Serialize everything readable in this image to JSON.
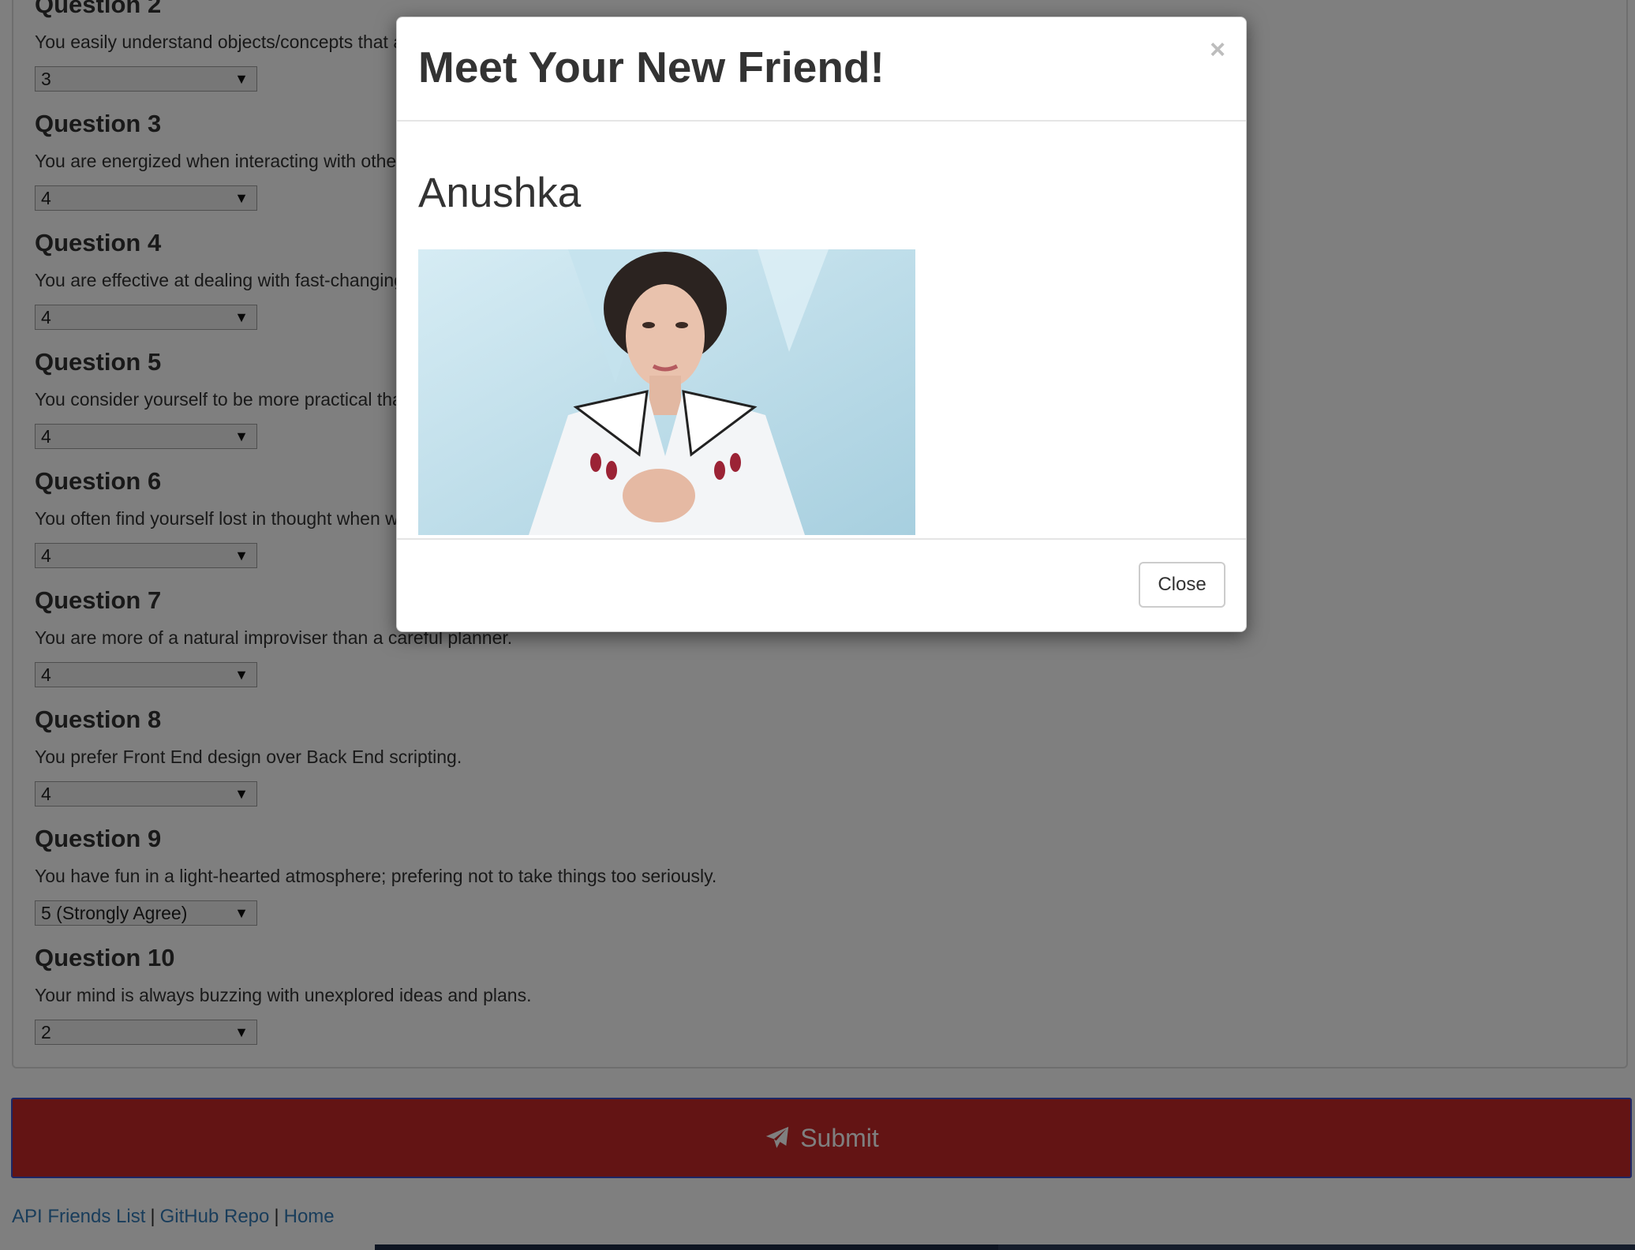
{
  "questions": [
    {
      "title": "Question 2",
      "text": "You easily understand objects/concepts that are not fully developed.",
      "selected": "3"
    },
    {
      "title": "Question 3",
      "text": "You are energized when interacting with others.",
      "selected": "4"
    },
    {
      "title": "Question 4",
      "text": "You are effective at dealing with fast-changing situations.",
      "selected": "4"
    },
    {
      "title": "Question 5",
      "text": "You consider yourself to be more practical than creative.",
      "selected": "4"
    },
    {
      "title": "Question 6",
      "text": "You often find yourself lost in thought when walking in nature.",
      "selected": "4"
    },
    {
      "title": "Question 7",
      "text": "You are more of a natural improviser than a careful planner.",
      "selected": "4"
    },
    {
      "title": "Question 8",
      "text": "You prefer Front End design over Back End scripting.",
      "selected": "4"
    },
    {
      "title": "Question 9",
      "text": "You have fun in a light-hearted atmosphere; prefering not to take things too seriously.",
      "selected": "5 (Strongly Agree)"
    },
    {
      "title": "Question 10",
      "text": "Your mind is always buzzing with unexplored ideas and plans.",
      "selected": "2"
    }
  ],
  "submit": {
    "label": "Submit",
    "icon": "paper-plane-icon"
  },
  "footer": {
    "links": [
      "API Friends List",
      "GitHub Repo",
      "Home"
    ],
    "separator": "|"
  },
  "modal": {
    "title": "Meet Your New Friend!",
    "close_x": "×",
    "friend_name": "Anushka",
    "close_label": "Close"
  },
  "colors": {
    "submit_bg": "#c62828",
    "link": "#337ab7",
    "text": "#333333"
  }
}
